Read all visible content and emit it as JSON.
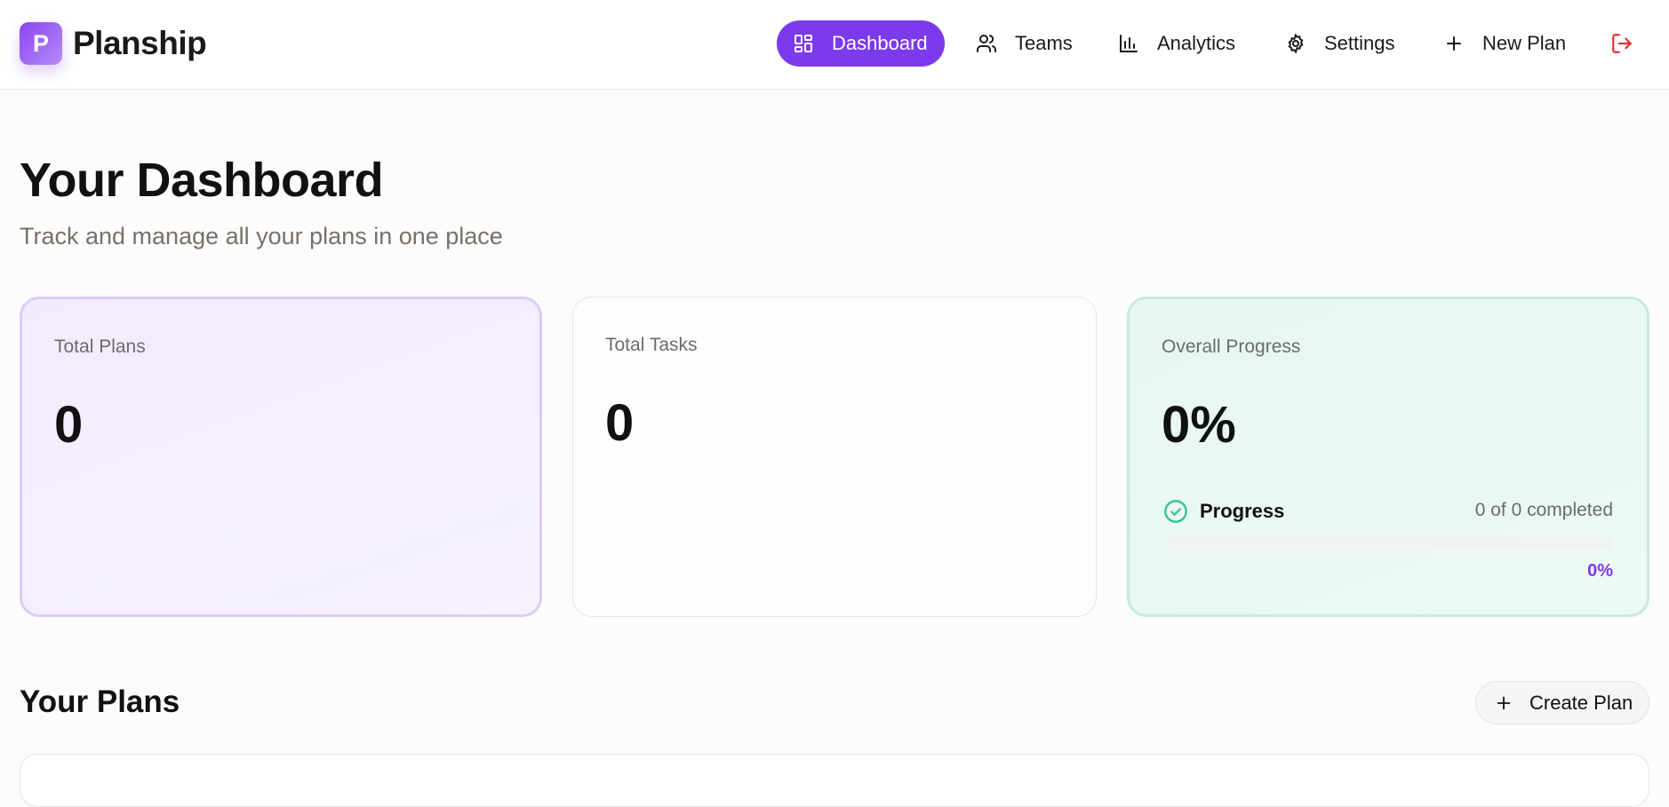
{
  "brand": {
    "initial": "P",
    "name": "Planship",
    "accent_color": "#7c3aed"
  },
  "nav": {
    "items": [
      {
        "label": "Dashboard",
        "icon": "dashboard-grid-icon",
        "active": true
      },
      {
        "label": "Teams",
        "icon": "users-icon",
        "active": false
      },
      {
        "label": "Analytics",
        "icon": "bar-chart-icon",
        "active": false
      },
      {
        "label": "Settings",
        "icon": "gear-icon",
        "active": false
      },
      {
        "label": "New Plan",
        "icon": "plus-icon",
        "active": false
      }
    ],
    "logout_icon": "logout-icon",
    "logout_color": "#e03131"
  },
  "page": {
    "title": "Your Dashboard",
    "subtitle": "Track and manage all your plans in one place"
  },
  "stats": {
    "plans": {
      "label": "Total Plans",
      "value": "0"
    },
    "tasks": {
      "label": "Total Tasks",
      "value": "0"
    },
    "progress": {
      "label": "Overall Progress",
      "value": "0%",
      "row_label": "Progress",
      "count_text": "0 of 0 completed",
      "percent_text": "0%",
      "fraction": 0,
      "check_icon": "check-circle-icon",
      "check_color": "#34c38f"
    }
  },
  "plans_section": {
    "title": "Your Plans",
    "create_label": "Create Plan"
  }
}
